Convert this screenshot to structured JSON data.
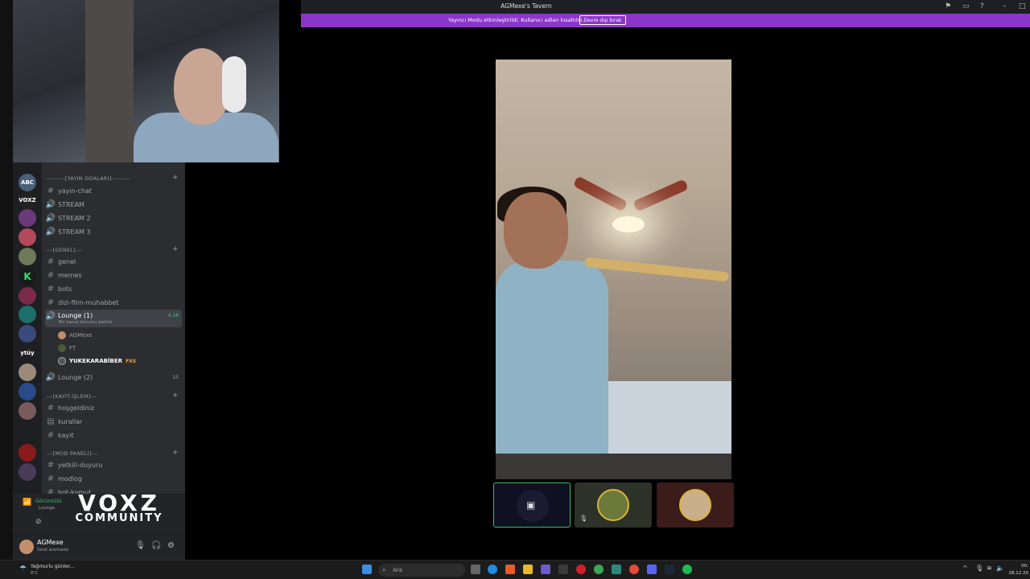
{
  "window": {
    "title": "AGMexe's Tavern"
  },
  "banner": {
    "message": "Yayıncı Modu etkinleştirildi. Kullanıcı adları kısaltıldı.",
    "button": "Devre dışı bırak"
  },
  "server_rail": {
    "icons": [
      "ABC",
      "VOXZ",
      "K",
      "ytüy"
    ]
  },
  "channels": {
    "categories": [
      {
        "label": "---------[YAYIN ODALARI]---------"
      },
      {
        "label": "---[GENEL]---"
      },
      {
        "label": "---[KAYIT-İŞLEM]---"
      },
      {
        "label": "---[MOD PANELİ]---"
      }
    ],
    "items": [
      {
        "label": "yayın-chat"
      },
      {
        "label": "STREAM"
      },
      {
        "label": "STREAM 2"
      },
      {
        "label": "STREAM 3"
      },
      {
        "label": "genel"
      },
      {
        "label": "memes"
      },
      {
        "label": "bots"
      },
      {
        "label": "dizi-film-muhabbet"
      },
      {
        "label": "Lounge (1)",
        "status": "Bir kanal durumu belirle",
        "time": "4:18"
      },
      {
        "label": "Lounge (2)",
        "count": "15"
      },
      {
        "label": "hoşgeldiniz"
      },
      {
        "label": "kurallar"
      },
      {
        "label": "kayıt"
      },
      {
        "label": "yetkili-duyuru"
      },
      {
        "label": "modlog"
      },
      {
        "label": "bot-komut"
      }
    ],
    "members": [
      {
        "name": "AGMexe"
      },
      {
        "name": "FT"
      },
      {
        "name": "YUKEKARABİBER",
        "tag": "FXS"
      }
    ]
  },
  "voice_panel": {
    "status": "Görüntülü",
    "channel": "Lounge"
  },
  "brand_overlay": {
    "line1": "VOXZ",
    "line2": "COMMUNITY"
  },
  "user_panel": {
    "name": "AGMexe",
    "status": "Sesli aramada"
  },
  "taskbar": {
    "weather": "Yağmurlu günler...",
    "temp": "8°C",
    "search_placeholder": "Ara",
    "time": "00:",
    "date": "28.12.20"
  },
  "colors": {
    "banner": "#8c36c9",
    "accent_green": "#34c06b",
    "sidebar": "#2b2d31"
  }
}
